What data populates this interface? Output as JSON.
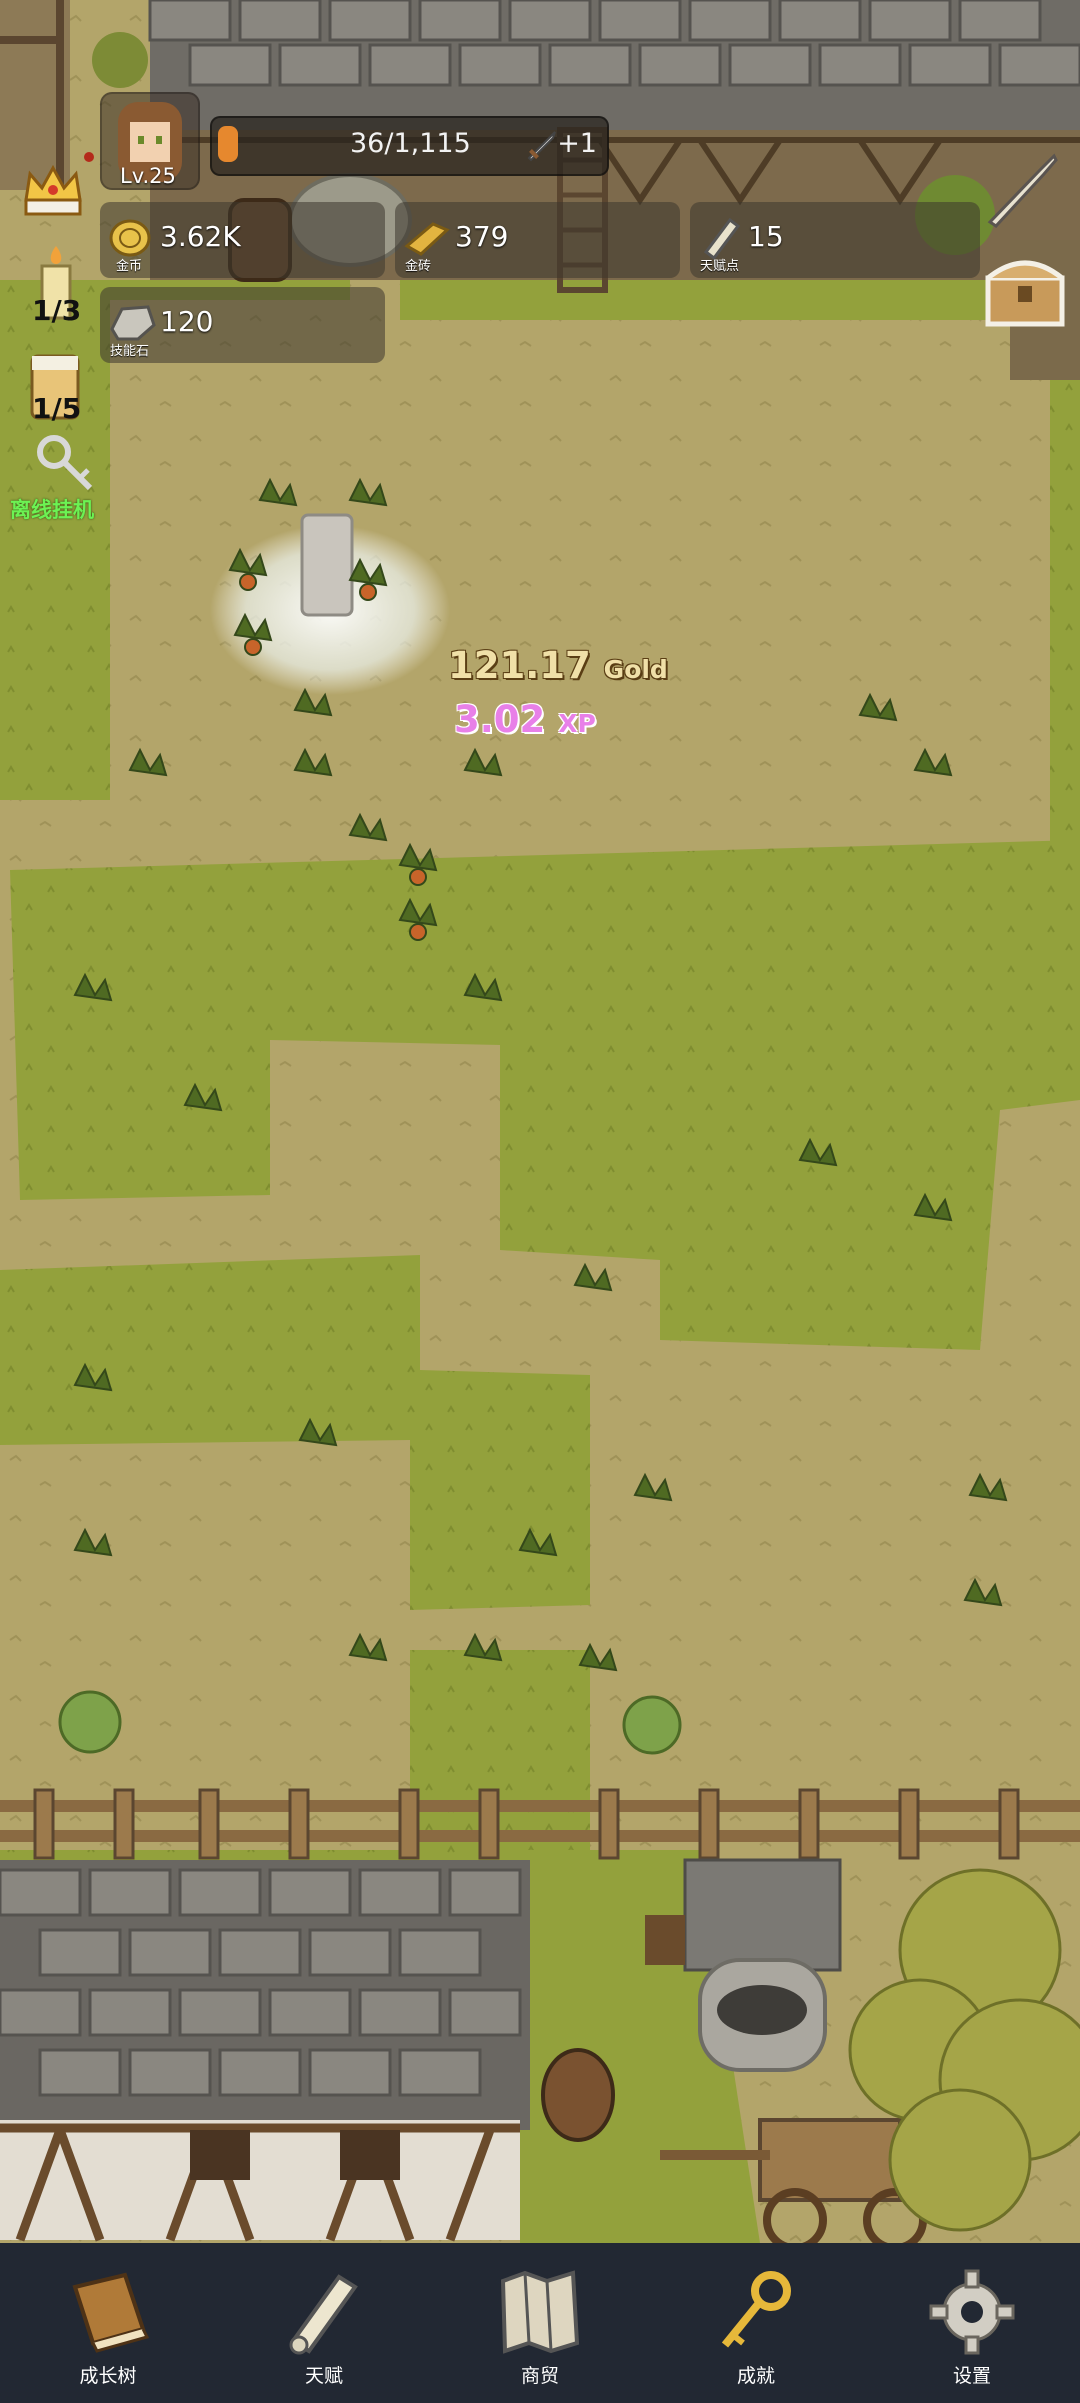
{
  "player": {
    "level_label": "Lv.25"
  },
  "xp_bar": {
    "text": "36/1,115",
    "progress": 0.032,
    "bonus_label": "+1"
  },
  "resources": [
    {
      "id": "gold",
      "value": "3.62K",
      "caption": "金币"
    },
    {
      "id": "gold-brick",
      "value": "379",
      "caption": "金砖"
    },
    {
      "id": "talent-point",
      "value": "15",
      "caption": "天赋点"
    },
    {
      "id": "skill-stone",
      "value": "120",
      "caption": "技能石"
    }
  ],
  "side": {
    "candle_count": "1/3",
    "beer_count": "1/5",
    "afk_label": "离线挂机"
  },
  "floating": {
    "gold_value": "121.17",
    "gold_unit": "Gold",
    "xp_value": "3.02",
    "xp_unit": "XP"
  },
  "nav": [
    {
      "id": "growth-tree",
      "label": "成长树",
      "icon": "book-icon"
    },
    {
      "id": "talent",
      "label": "天赋",
      "icon": "scroll-icon"
    },
    {
      "id": "trade",
      "label": "商贸",
      "icon": "map-icon"
    },
    {
      "id": "achievement",
      "label": "成就",
      "icon": "key-icon"
    },
    {
      "id": "settings",
      "label": "设置",
      "icon": "gear-icon"
    }
  ],
  "colors": {
    "grass": "#93a13c",
    "dirt": "#b3a56a",
    "nav_bg": "#222833",
    "xp_fill": "#e6882e"
  }
}
